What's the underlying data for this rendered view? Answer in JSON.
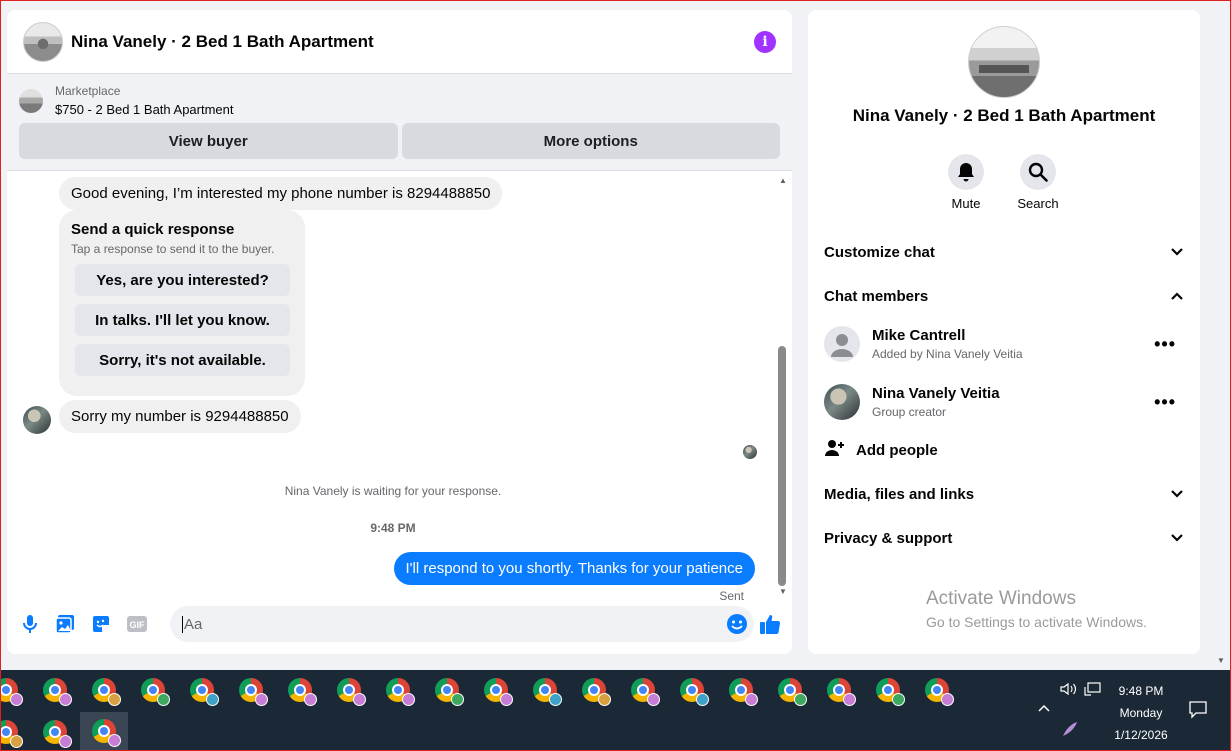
{
  "chat": {
    "title": "Nina Vanely · 2 Bed 1 Bath Apartment",
    "marketplace": {
      "label": "Marketplace",
      "item": "$750 - 2 Bed 1 Bath Apartment",
      "view_buyer": "View buyer",
      "more_options": "More options"
    },
    "messages": {
      "first": "Good evening, I’m interested my phone number is 8294488850",
      "quick_title": "Send a quick response",
      "quick_subtitle": "Tap a response to send it to the buyer.",
      "quick_options": [
        "Yes, are you interested?",
        "In talks. I'll let you know.",
        "Sorry, it's not available."
      ],
      "second": "Sorry my number is 9294488850",
      "waiting": "Nina Vanely is waiting for your response.",
      "time": "9:48 PM",
      "outgoing": "I'll respond to you shortly. Thanks for your patience",
      "status": "Sent"
    },
    "composer": {
      "placeholder": "Aa"
    }
  },
  "info_panel": {
    "name": "Nina Vanely · 2 Bed 1 Bath Apartment",
    "actions": [
      "Mute",
      "Search"
    ],
    "sections": {
      "customize": "Customize chat",
      "members": "Chat members",
      "media": "Media, files and links",
      "privacy": "Privacy & support"
    },
    "members": [
      {
        "name": "Mike Cantrell",
        "sub": "Added by Nina Vanely Veitia"
      },
      {
        "name": "Nina Vanely Veitia",
        "sub": "Group creator"
      }
    ],
    "add_people": "Add people",
    "more_glyph": "•••"
  },
  "watermark": {
    "line1": "Activate Windows",
    "line2": "Go to Settings to activate Windows."
  },
  "taskbar": {
    "time": "9:48 PM",
    "day": "Monday",
    "date": "1/12/2026",
    "badge_colors": [
      "#c77dd6",
      "#c77dd6",
      "#d8a040",
      "#3fa860",
      "#3fa0c8",
      "#c77dd6",
      "#c77dd6",
      "#c77dd6",
      "#c77dd6",
      "#3fa860",
      "#c77dd6",
      "#3fa0c8",
      "#d8a040",
      "#c77dd6",
      "#3fa0c8",
      "#c77dd6",
      "#3fa860",
      "#c77dd6",
      "#3fa860",
      "#c77dd6",
      "#d8a040",
      "#c77dd6",
      "#c77dd6"
    ]
  },
  "colors": {
    "accent": "#0a7cff",
    "info": "#a033ff",
    "taskbar": "#1b2836"
  }
}
